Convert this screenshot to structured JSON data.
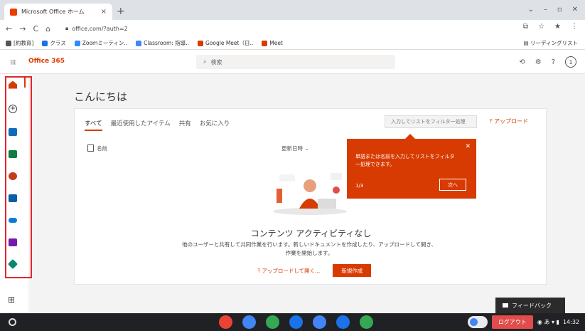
{
  "browser": {
    "tab_title": "Microsoft Office ホーム",
    "tab_close": "×",
    "new_tab": "+",
    "win_controls": [
      "⌄",
      "–",
      "▫",
      "✕"
    ],
    "nav": [
      "←",
      "→",
      "C",
      "⌂"
    ],
    "url": "office.com/?auth=2",
    "toolbar_icons": [
      "⧉",
      "☆",
      "★",
      "⋮"
    ],
    "bookmarks": [
      {
        "label": "[約教育]",
        "color": "#555555"
      },
      {
        "label": "クラス",
        "color": "#1a73e8"
      },
      {
        "label": "Zoomミーティン..",
        "color": "#2d8cff"
      },
      {
        "label": "Classroom: 指導..",
        "color": "#4285f4"
      },
      {
        "label": "Google Meet（日..",
        "color": "#d83b01"
      },
      {
        "label": "Meet",
        "color": "#d83b01"
      }
    ],
    "reading_list": "リーディングリスト"
  },
  "appbar": {
    "brand": "Office 365",
    "search_placeholder": "検索",
    "avatar": "1",
    "icons": [
      "⟲",
      "⚙",
      "?"
    ]
  },
  "rail": {
    "apps": [
      {
        "name": "home",
        "color": "#d83b01"
      },
      {
        "name": "create",
        "color": "#444444"
      },
      {
        "name": "outlook",
        "color": "#0f6cbd"
      },
      {
        "name": "onedrive-excel",
        "color": "#107c41"
      },
      {
        "name": "powerpoint",
        "color": "#c43e1c"
      },
      {
        "name": "outlook-alt",
        "color": "#0a5ea8"
      },
      {
        "name": "onedrive",
        "color": "#0a7bd7"
      },
      {
        "name": "onenote",
        "color": "#7719aa"
      },
      {
        "name": "sway",
        "color": "#088a6a"
      }
    ],
    "all_apps_icon": "⊞"
  },
  "main": {
    "greeting": "こんにちは",
    "tabs": [
      "すべて",
      "最近使用したアイテム",
      "共有",
      "お気に入り"
    ],
    "filter_placeholder": "入力してリストをフィルター処理",
    "upload": "⤒ アップロード",
    "col_name": "名前",
    "col_modified": "更新日時 ⌄",
    "empty_title": "コンテンツ アクティビティなし",
    "empty_desc": "他のユーザーと共有して共同作業を行います。新しいドキュメントを作成したり、アップロードして開き、作業を開始します。",
    "btn_upload": "⤒ アップロードして開く...",
    "btn_new": "新規作成"
  },
  "tooltip": {
    "message": "単語または名前を入力してリストをフィルター処理できます。",
    "step": "1/3",
    "next": "次へ",
    "close": "✕"
  },
  "feedback": "フィードバック",
  "shelf": {
    "apps": [
      "#ea4335",
      "#4285f4",
      "#34a853",
      "#1a73e8",
      "#4285f4",
      "#1a73e8",
      "#34a853"
    ],
    "logout": "ログアウト",
    "time": "14:32",
    "status": "◉ あ ▾ ▮"
  }
}
